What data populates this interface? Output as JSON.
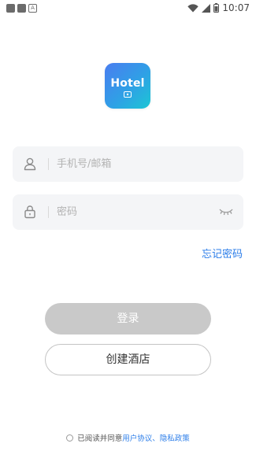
{
  "status_bar": {
    "time": "10:07",
    "left_icons": [
      "square-icon",
      "square-icon",
      "a-notification-icon"
    ],
    "right_icons": [
      "wifi-icon",
      "signal-icon",
      "battery-icon"
    ]
  },
  "logo": {
    "text": "Hotel",
    "colors": [
      "#4a7df0",
      "#2fa0e6",
      "#1cc6d4"
    ]
  },
  "login_form": {
    "account_placeholder": "手机号/邮箱",
    "account_value": "",
    "password_placeholder": "密码",
    "password_value": "",
    "account_icon": "user-icon",
    "password_icon": "lock-icon",
    "password_toggle_icon": "eye-closed-icon",
    "forgot_label": "忘记密码"
  },
  "buttons": {
    "login_label": "登录",
    "create_label": "创建酒店"
  },
  "agreement": {
    "prefix": "已阅读并同意",
    "terms_link": "用户协议",
    "separator": "、",
    "privacy_link": "隐私政策",
    "checked": false
  },
  "colors": {
    "accent": "#2b7de9",
    "login_disabled": "#c9c9c9",
    "input_bg": "#f4f5f7"
  }
}
